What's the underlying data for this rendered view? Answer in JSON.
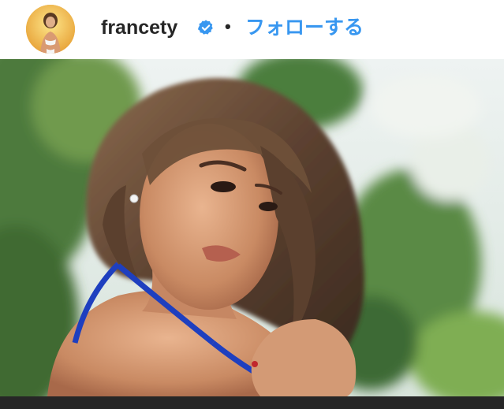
{
  "post_header": {
    "username": "francety",
    "verified_icon": "verified-badge-icon",
    "separator": "•",
    "follow_label": "フォローする",
    "accent_color": "#3897f0",
    "verified_color": "#3897f0"
  },
  "post": {
    "photo_icon": "post-photo"
  }
}
